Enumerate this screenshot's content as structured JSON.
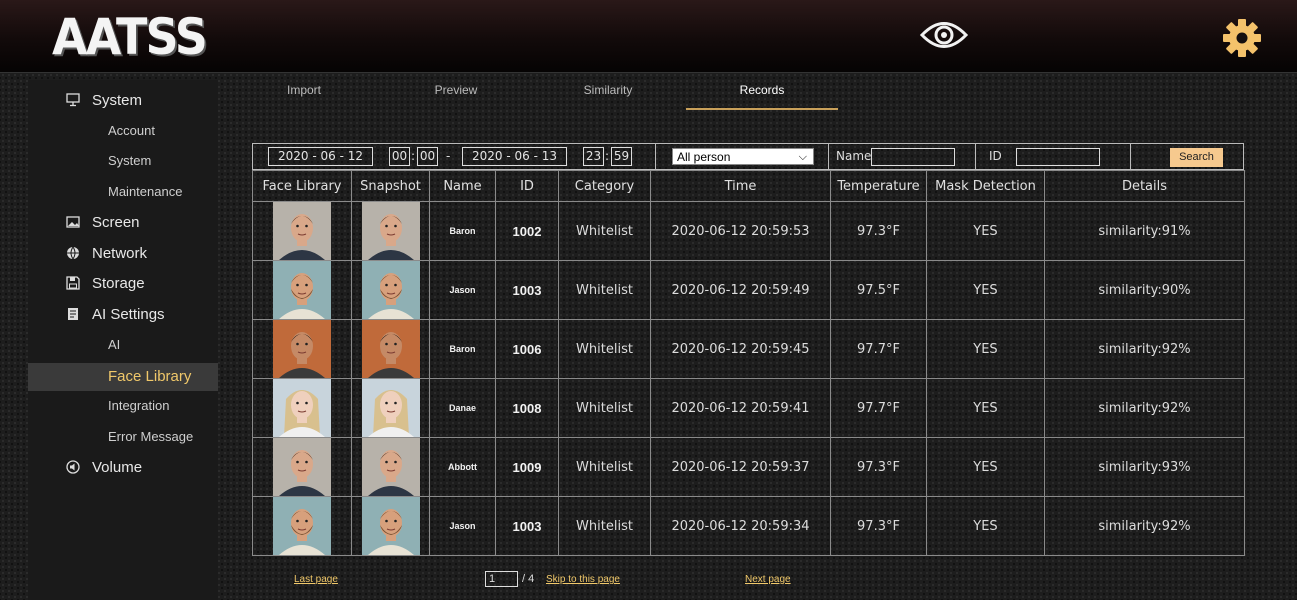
{
  "app": {
    "logo_text": "AATSS",
    "eye_icon": "eye-icon",
    "settings_icon": "gear-icon"
  },
  "sidebar": {
    "system": {
      "label": "System",
      "icon": "monitor-icon"
    },
    "system_sub": [
      {
        "label": "Account"
      },
      {
        "label": "System"
      },
      {
        "label": "Maintenance"
      }
    ],
    "screen": {
      "label": "Screen",
      "icon": "image-icon"
    },
    "network": {
      "label": "Network",
      "icon": "globe-icon"
    },
    "storage": {
      "label": "Storage",
      "icon": "save-icon"
    },
    "ai_settings": {
      "label": "AI Settings",
      "icon": "document-icon"
    },
    "ai_sub": [
      {
        "label": "AI"
      },
      {
        "label": "Face Library",
        "active": true
      },
      {
        "label": "Integration"
      },
      {
        "label": "Error Message"
      }
    ],
    "volume": {
      "label": "Volume",
      "icon": "speaker-icon"
    }
  },
  "tabs": [
    {
      "label": "Import"
    },
    {
      "label": "Preview"
    },
    {
      "label": "Similarity"
    },
    {
      "label": "Records",
      "active": true
    }
  ],
  "filter": {
    "start_date": "2020 - 06 - 12",
    "start_hour": "00",
    "start_min": "00",
    "dash": "-",
    "end_date": "2020 - 06 - 13",
    "end_hour": "23",
    "end_min": "59",
    "colon": ":",
    "person_select": "All person",
    "name_label": "Name",
    "name_value": "",
    "id_label": "ID",
    "id_value": "",
    "search_label": "Search"
  },
  "table": {
    "headers": [
      "Face Library",
      "Snapshot",
      "Name",
      "ID",
      "Category",
      "Time",
      "Temperature",
      "Mask Detection",
      "Details"
    ],
    "rows": [
      {
        "name": "Baron",
        "id": "1002",
        "category": "Whitelist",
        "time": "2020-06-12 20:59:53",
        "temperature": "97.3°F",
        "mask": "YES",
        "details": "similarity:91%",
        "face": "man1"
      },
      {
        "name": "Jason",
        "id": "1003",
        "category": "Whitelist",
        "time": "2020-06-12 20:59:49",
        "temperature": "97.5°F",
        "mask": "YES",
        "details": "similarity:90%",
        "face": "man2"
      },
      {
        "name": "Baron",
        "id": "1006",
        "category": "Whitelist",
        "time": "2020-06-12 20:59:45",
        "temperature": "97.7°F",
        "mask": "YES",
        "details": "similarity:92%",
        "face": "man3"
      },
      {
        "name": "Danae",
        "id": "1008",
        "category": "Whitelist",
        "time": "2020-06-12 20:59:41",
        "temperature": "97.7°F",
        "mask": "YES",
        "details": "similarity:92%",
        "face": "woman"
      },
      {
        "name": "Abbott",
        "id": "1009",
        "category": "Whitelist",
        "time": "2020-06-12 20:59:37",
        "temperature": "97.3°F",
        "mask": "YES",
        "details": "similarity:93%",
        "face": "man1"
      },
      {
        "name": "Jason",
        "id": "1003",
        "category": "Whitelist",
        "time": "2020-06-12 20:59:34",
        "temperature": "97.3°F",
        "mask": "YES",
        "details": "similarity:92%",
        "face": "man2"
      }
    ]
  },
  "pager": {
    "last_page": "Last page",
    "current_page": "1",
    "total_pages": "/ 4",
    "skip_label": "Skip to this page",
    "next_page": "Next page"
  },
  "colors": {
    "accent": "#f0c86a",
    "search_button": "#f6c98e",
    "tab_underline": "#c8a05a"
  }
}
